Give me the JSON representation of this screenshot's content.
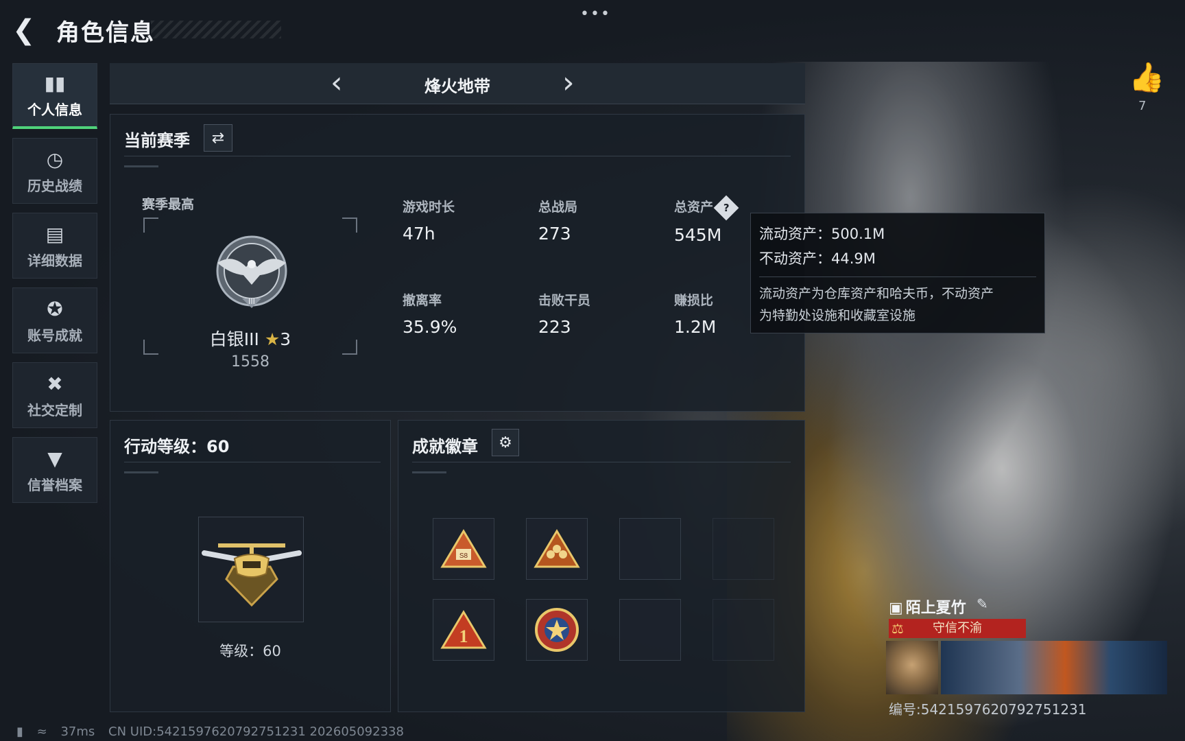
{
  "header": {
    "title": "角色信息"
  },
  "sidebar": {
    "items": [
      {
        "label": "个人信息",
        "icon": "bar-chart-icon",
        "active": true
      },
      {
        "label": "历史战绩",
        "icon": "clock-history-icon",
        "active": false
      },
      {
        "label": "详细数据",
        "icon": "folder-icon",
        "active": false
      },
      {
        "label": "账号成就",
        "icon": "medal-icon",
        "active": false
      },
      {
        "label": "社交定制",
        "icon": "tools-icon",
        "active": false
      },
      {
        "label": "信誉档案",
        "icon": "shield-icon",
        "active": false
      }
    ]
  },
  "mode": {
    "name": "烽火地带"
  },
  "season": {
    "title": "当前赛季",
    "best_label": "赛季最高",
    "rank": {
      "name": "白银III",
      "stars": "3",
      "score": "1558"
    },
    "stats": [
      {
        "label": "游戏时长",
        "value": "47h"
      },
      {
        "label": "总战局",
        "value": "273"
      },
      {
        "label": "总资产",
        "value": "545M"
      },
      {
        "label": "撤离率",
        "value": "35.9%"
      },
      {
        "label": "击败干员",
        "value": "223"
      },
      {
        "label": "赚损比",
        "value": "1.2M"
      }
    ]
  },
  "tooltip": {
    "liquid": "流动资产：500.1M",
    "fixed": "不动资产：44.9M",
    "desc_line1": "流动资产为仓库资产和哈夫币，不动资产",
    "desc_line2": "为特勤处设施和收藏室设施"
  },
  "level": {
    "title": "行动等级：60",
    "text": "等级：60"
  },
  "achievements": {
    "title": "成就徽章"
  },
  "profile": {
    "name": "陌上夏竹",
    "reputation": "守信不渝",
    "uid": "编号:5421597620792751231"
  },
  "likes": {
    "count": "7"
  },
  "footer": {
    "ping": "37ms",
    "uid": "CN UID:5421597620792751231 202605092338"
  },
  "colors": {
    "accent_green": "#4fd27a",
    "reputation_red": "#b3231f",
    "gold": "#d9b445"
  }
}
